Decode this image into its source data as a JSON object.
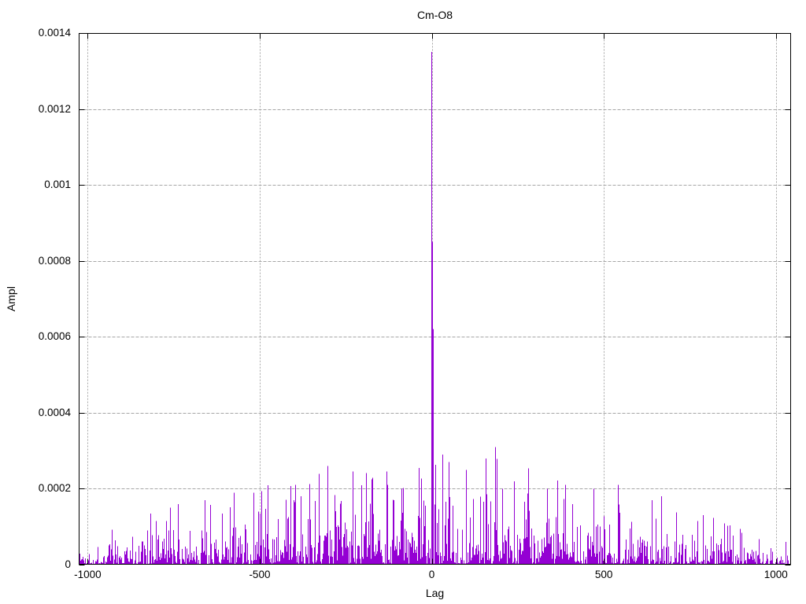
{
  "window": {
    "background": "#ffffff",
    "text_color": "#000000"
  },
  "chart_data": {
    "type": "line",
    "style": "impulses",
    "title": "Cm-O8",
    "xlabel": "Lag",
    "ylabel": "Ampl",
    "xlim": [
      -1026,
      1044
    ],
    "ylim": [
      0,
      0.0014
    ],
    "x_ticks": [
      {
        "value": -1000,
        "label": "-1000"
      },
      {
        "value": -500,
        "label": "-500"
      },
      {
        "value": 0,
        "label": "0"
      },
      {
        "value": 500,
        "label": "500"
      },
      {
        "value": 1000,
        "label": "1000"
      }
    ],
    "y_ticks": [
      {
        "value": 0,
        "label": "0"
      },
      {
        "value": 0.0002,
        "label": "0.0002"
      },
      {
        "value": 0.0004,
        "label": "0.0004"
      },
      {
        "value": 0.0006,
        "label": "0.0006"
      },
      {
        "value": 0.0008,
        "label": "0.0008"
      },
      {
        "value": 0.001,
        "label": "0.001"
      },
      {
        "value": 0.0012,
        "label": "0.0012"
      },
      {
        "value": 0.0014,
        "label": "0.0014"
      }
    ],
    "grid": true,
    "legend": "none",
    "axis_color": "#000000",
    "grid_color": "#a6a6a6",
    "series": [
      {
        "name": "Cm-O8",
        "color": "#9400d3",
        "central_peak": {
          "lag": 0,
          "ampl": 0.00135
        },
        "shoulder_points": [
          {
            "lag": -1,
            "ampl": 0.00085
          },
          {
            "lag": 1,
            "ampl": 0.00062
          }
        ],
        "notable_peaks": [
          {
            "lag": -760,
            "ampl": 0.00015
          },
          {
            "lag": -660,
            "ampl": 0.00017
          },
          {
            "lag": -575,
            "ampl": 0.00019
          },
          {
            "lag": -518,
            "ampl": 0.00019
          },
          {
            "lag": -395,
            "ampl": 0.00021
          },
          {
            "lag": -303,
            "ampl": 0.00026
          },
          {
            "lag": -230,
            "ampl": 0.000245
          },
          {
            "lag": -130,
            "ampl": 0.000245
          },
          {
            "lag": -36,
            "ampl": 0.000255
          },
          {
            "lag": 31,
            "ampl": 0.00029
          },
          {
            "lag": 51,
            "ampl": 0.00027
          },
          {
            "lag": 100,
            "ampl": 0.00025
          },
          {
            "lag": 157,
            "ampl": 0.00028
          },
          {
            "lag": 184,
            "ampl": 0.00031
          },
          {
            "lag": 240,
            "ampl": 0.00022
          },
          {
            "lag": 335,
            "ampl": 0.0002
          },
          {
            "lag": 389,
            "ampl": 0.00021
          },
          {
            "lag": 472,
            "ampl": 0.0002
          },
          {
            "lag": 543,
            "ampl": 0.00021
          },
          {
            "lag": 640,
            "ampl": 0.00017
          },
          {
            "lag": 790,
            "ampl": 0.00013
          }
        ],
        "noise_envelope": [
          {
            "lag": -1026,
            "ampl": 4e-05
          },
          {
            "lag": -1000,
            "ampl": 5e-05
          },
          {
            "lag": -900,
            "ampl": 7e-05
          },
          {
            "lag": -800,
            "ampl": 9e-05
          },
          {
            "lag": -700,
            "ampl": 0.00011
          },
          {
            "lag": -600,
            "ampl": 0.00012
          },
          {
            "lag": -500,
            "ampl": 0.00013
          },
          {
            "lag": -400,
            "ampl": 0.00015
          },
          {
            "lag": -300,
            "ampl": 0.00016
          },
          {
            "lag": -200,
            "ampl": 0.000155
          },
          {
            "lag": -100,
            "ampl": 0.00016
          },
          {
            "lag": -40,
            "ampl": 0.00017
          },
          {
            "lag": 0,
            "ampl": 0.00017
          },
          {
            "lag": 60,
            "ampl": 0.00017
          },
          {
            "lag": 120,
            "ampl": 0.00018
          },
          {
            "lag": 200,
            "ampl": 0.00018
          },
          {
            "lag": 300,
            "ampl": 0.00016
          },
          {
            "lag": 400,
            "ampl": 0.000155
          },
          {
            "lag": 500,
            "ampl": 0.00015
          },
          {
            "lag": 560,
            "ampl": 0.00014
          },
          {
            "lag": 650,
            "ampl": 0.00012
          },
          {
            "lag": 750,
            "ampl": 0.0001
          },
          {
            "lag": 850,
            "ampl": 7e-05
          },
          {
            "lag": 950,
            "ampl": 5e-05
          },
          {
            "lag": 1044,
            "ampl": 4e-05
          }
        ],
        "noise_seed": 1337
      }
    ]
  }
}
